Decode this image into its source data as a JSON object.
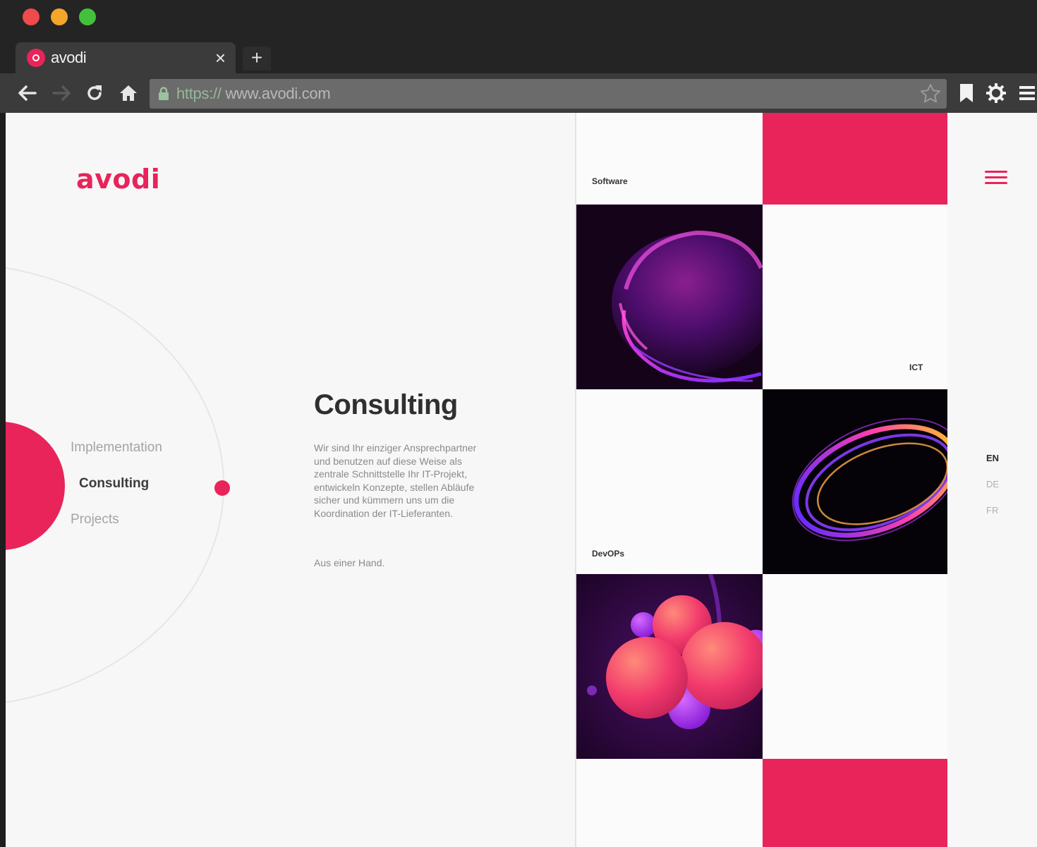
{
  "browser": {
    "tab_title": "avodi",
    "tab_close": "×",
    "new_tab": "+",
    "url_scheme": "https://",
    "url_host": " www.avodi.com"
  },
  "site": {
    "logo": "avodi",
    "nav": [
      {
        "label": "Implementation"
      },
      {
        "label": "Consulting",
        "active": true
      },
      {
        "label": "Projects"
      }
    ],
    "content": {
      "title": "Consulting",
      "body": "Wir sind Ihr einziger Ansprechpartner und benutzen auf diese Weise als zentrale Schnittstelle Ihr IT-Projekt, entwickeln Konzepte, stellen Abläufe sicher und kümmern uns um die Koordination der IT-Lieferanten.",
      "tagline": "Aus einer Hand."
    },
    "tiles": {
      "software": "Software",
      "ict": "ICT",
      "devops": "DevOPs"
    },
    "languages": [
      {
        "code": "EN",
        "active": true
      },
      {
        "code": "DE"
      },
      {
        "code": "FR"
      }
    ]
  },
  "colors": {
    "accent": "#e8245a"
  }
}
